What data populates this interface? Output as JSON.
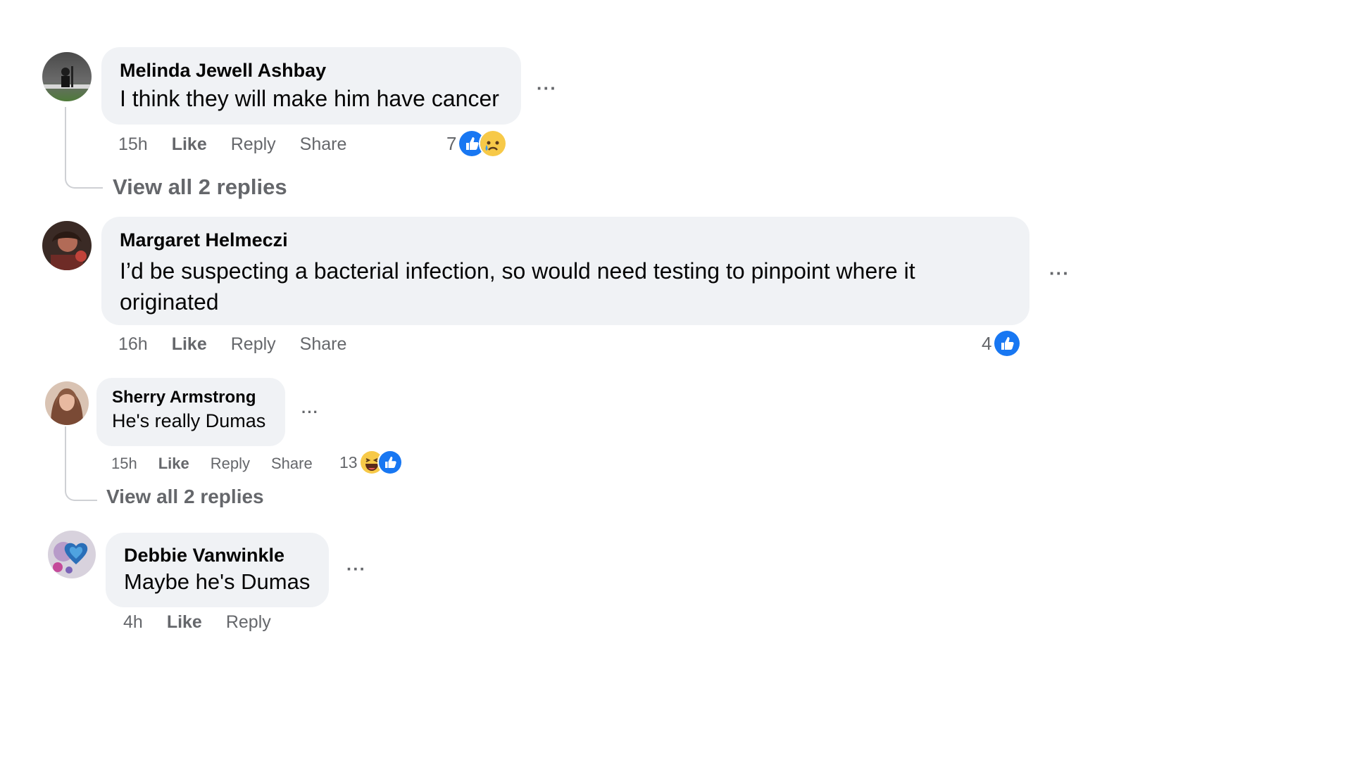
{
  "comments": [
    {
      "author": "Melinda Jewell Ashbay",
      "text": "I think they will make him have cancer",
      "time": "15h",
      "like": "Like",
      "reply": "Reply",
      "share": "Share",
      "reaction_count": "7",
      "reactions": [
        "like-icon",
        "sad-icon"
      ],
      "more": "···",
      "view_replies": "View all 2 replies"
    },
    {
      "author": "Margaret Helmeczi",
      "text": "I’d be suspecting a bacterial infection, so would need testing to pinpoint where it originated",
      "time": "16h",
      "like": "Like",
      "reply": "Reply",
      "share": "Share",
      "reaction_count": "4",
      "reactions": [
        "like-icon"
      ],
      "more": "···"
    },
    {
      "author": "Sherry Armstrong",
      "text": "He's really Dumas",
      "time": "15h",
      "like": "Like",
      "reply": "Reply",
      "share": "Share",
      "reaction_count": "13",
      "reactions": [
        "haha-icon",
        "like-icon"
      ],
      "more": "···",
      "view_replies": "View all 2 replies"
    },
    {
      "author": "Debbie Vanwinkle",
      "text": "Maybe he's Dumas",
      "time": "4h",
      "like": "Like",
      "reply": "Reply",
      "more": "···"
    }
  ],
  "colors": {
    "bubble": "#f0f2f5",
    "secondary_text": "#65676b",
    "like_blue": "#1877f2",
    "thread_line": "#ced0d4"
  }
}
